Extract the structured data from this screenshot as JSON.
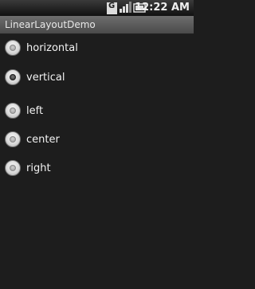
{
  "status_bar": {
    "time": "12:22 AM",
    "icons": [
      "network-type-icon",
      "signal-strength-icon",
      "battery-icon"
    ],
    "network_label": "G"
  },
  "app": {
    "title": "LinearLayoutDemo"
  },
  "orientation_group": {
    "options": [
      {
        "label": "horizontal",
        "checked": false
      },
      {
        "label": "vertical",
        "checked": true
      }
    ]
  },
  "gravity_group": {
    "options": [
      {
        "label": "left",
        "checked": false
      },
      {
        "label": "center",
        "checked": false
      },
      {
        "label": "right",
        "checked": false
      }
    ]
  },
  "colors": {
    "background": "#1d1d1d",
    "title_bar": "#5a5a5a",
    "text": "#f2f2f2"
  }
}
